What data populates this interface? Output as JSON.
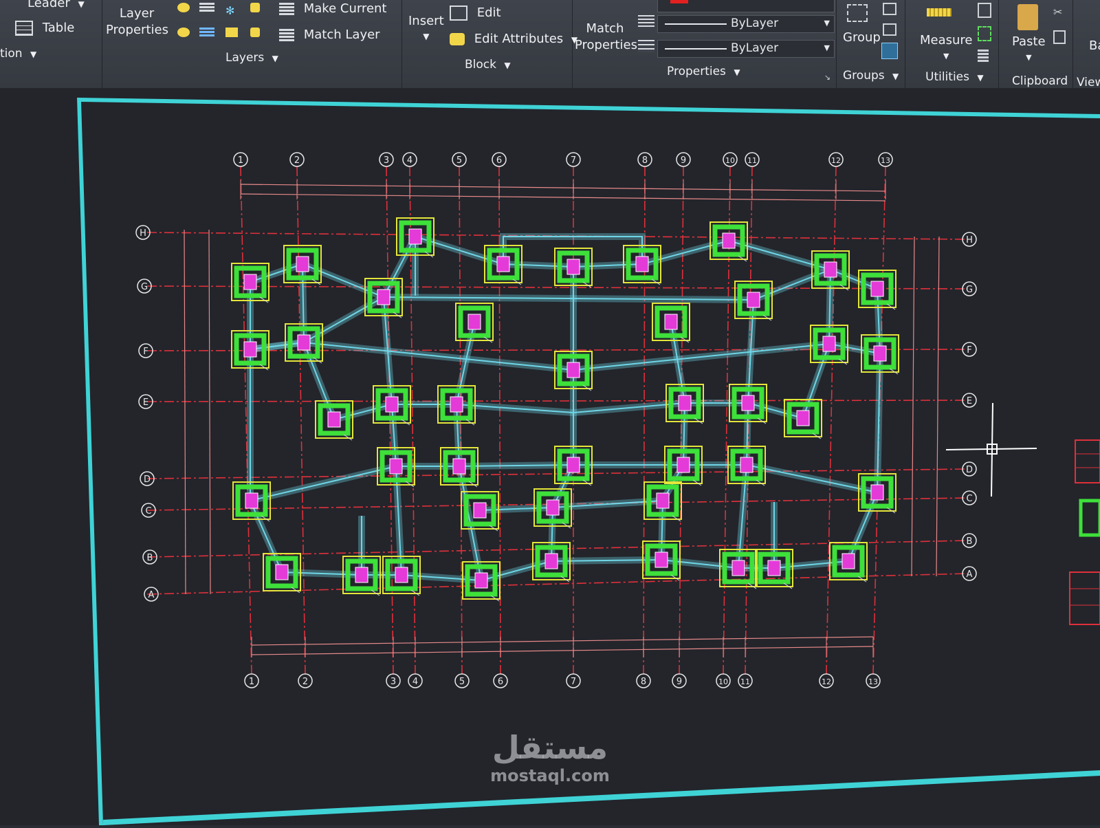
{
  "ribbon": {
    "leader_label": "Leader",
    "table_label": "Table",
    "annotation_label": "tion",
    "layer_properties_label": "Layer Properties",
    "layers_panel_label": "Layers",
    "make_current_label": "Make Current",
    "match_layer_label": "Match Layer",
    "insert_label": "Insert",
    "edit_label": "Edit",
    "edit_attributes_label": "Edit Attributes",
    "block_panel_label": "Block",
    "match_properties_label": "Match Properties",
    "linetype_value": "ByLayer",
    "lineweight_value": "ByLayer",
    "properties_panel_label": "Properties",
    "group_label": "Group",
    "groups_panel_label": "Groups",
    "measure_label": "Measure",
    "utilities_panel_label": "Utilities",
    "paste_label": "Paste",
    "clipboard_panel_label": "Clipboard",
    "view_panel_label": "View",
    "ba_label": "Ba"
  },
  "drawing": {
    "grid_columns": [
      "1",
      "2",
      "3",
      "4",
      "5",
      "6",
      "7",
      "8",
      "9",
      "10",
      "11",
      "12",
      "13"
    ],
    "grid_rows": [
      "H",
      "G",
      "F",
      "E",
      "D",
      "C",
      "B",
      "A"
    ],
    "colors": {
      "background": "#23252b",
      "grid_line": "#e0303a",
      "beam": "#6fd6e6",
      "footing_outer": "#e4e63a",
      "footing_inner": "#3ee03a",
      "column": "#e43ad8",
      "crosshair": "#ffffff",
      "viewport_border": "#3fd3d6"
    }
  },
  "watermark": {
    "arabic": "مستقل",
    "latin": "mostaql.com"
  }
}
